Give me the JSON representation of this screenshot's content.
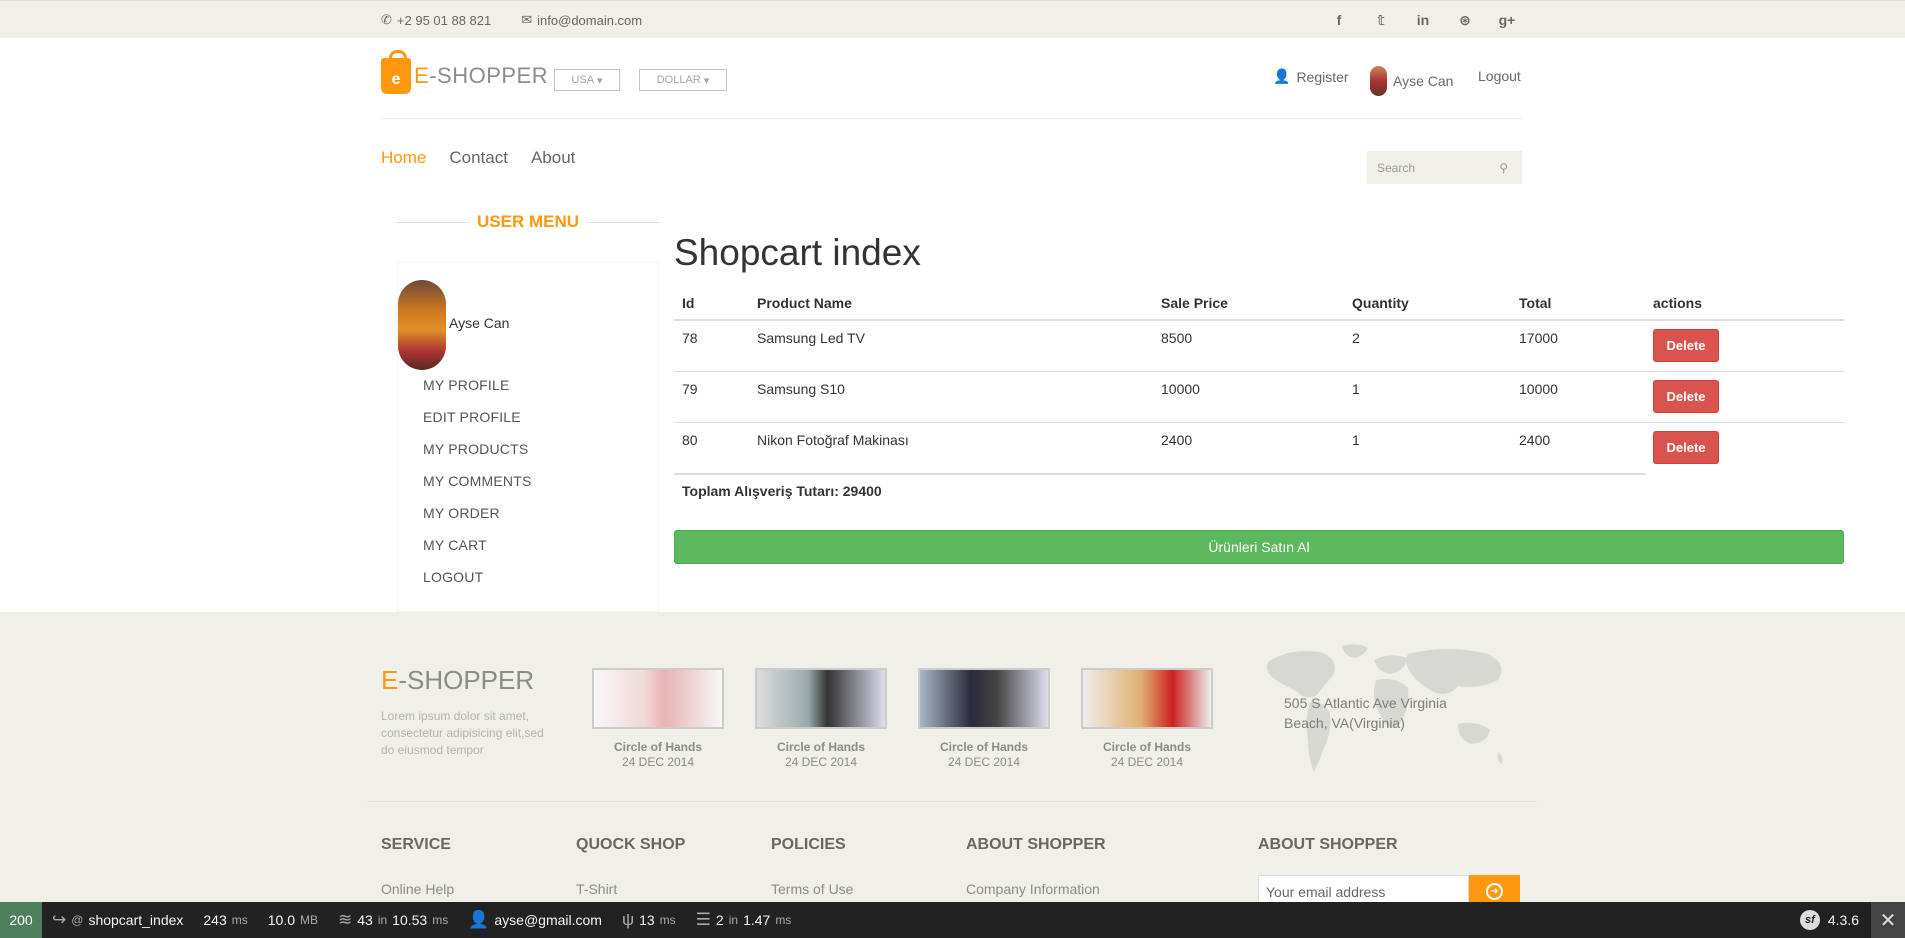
{
  "topbar": {
    "phone": "+2 95 01 88 821",
    "email": "info@domain.com",
    "social_icons": [
      "facebook-icon",
      "twitter-icon",
      "linkedin-icon",
      "dribbble-icon",
      "google-plus-icon"
    ],
    "social_glyphs": [
      "f",
      "𝕥",
      "in",
      "⊛",
      "g+"
    ]
  },
  "header": {
    "logo_e": "E",
    "logo_rest": "-SHOPPER",
    "country": "USA",
    "currency": "DOLLAR",
    "register": "Register",
    "user": "Ayse Can",
    "logout": "Logout"
  },
  "nav": {
    "home": "Home",
    "contact": "Contact",
    "about": "About",
    "search_placeholder": "Search"
  },
  "sidebar": {
    "title": "USER MENU",
    "name": "Ayse Can",
    "items": [
      "MY PROFILE",
      "EDIT PROFILE",
      "MY PRODUCTS",
      "MY COMMENTS",
      "MY ORDER",
      "MY CART",
      "LOGOUT"
    ]
  },
  "cart": {
    "title": "Shopcart index",
    "columns": [
      "Id",
      "Product Name",
      "Sale Price",
      "Quantity",
      "Total",
      "actions"
    ],
    "rows": [
      {
        "id": "78",
        "name": "Samsung Led TV",
        "price": "8500",
        "qty": "2",
        "total": "17000",
        "action": "Delete"
      },
      {
        "id": "79",
        "name": "Samsung S10",
        "price": "10000",
        "qty": "1",
        "total": "10000",
        "action": "Delete"
      },
      {
        "id": "80",
        "name": "Nikon Fotoğraf Makinası",
        "price": "2400",
        "qty": "1",
        "total": "2400",
        "action": "Delete"
      }
    ],
    "total_text": "Toplam Alışveriş Tutarı: 29400",
    "buy_button": "Ürünleri Satın Al"
  },
  "footer": {
    "logo_e": "E",
    "logo_rest": "-SHOPPER",
    "desc": "Lorem ipsum dolor sit amet, consectetur adipisicing elit,sed do eiusmod tempor",
    "videos": [
      {
        "title": "Circle of Hands",
        "date": "24 DEC 2014"
      },
      {
        "title": "Circle of Hands",
        "date": "24 DEC 2014"
      },
      {
        "title": "Circle of Hands",
        "date": "24 DEC 2014"
      },
      {
        "title": "Circle of Hands",
        "date": "24 DEC 2014"
      }
    ],
    "address": "505 S Atlantic Ave Virginia Beach, VA(Virginia)",
    "columns": [
      {
        "title": "SERVICE",
        "first": "Online Help"
      },
      {
        "title": "QUOCK SHOP",
        "first": "T-Shirt"
      },
      {
        "title": "POLICIES",
        "first": "Terms of Use"
      },
      {
        "title": "ABOUT SHOPPER",
        "first": "Company Information"
      },
      {
        "title": "ABOUT SHOPPER",
        "first": ""
      }
    ],
    "subscribe_placeholder": "Your email address"
  },
  "debug": {
    "status": "200",
    "route": "shopcart_index",
    "time": "243",
    "time_unit": "ms",
    "memory": "10.0",
    "memory_unit": "MB",
    "cache": "43",
    "cache_in": "in",
    "cache_time": "10.53",
    "cache_unit": "ms",
    "user": "ayse@gmail.com",
    "twig": "13",
    "twig_unit": "ms",
    "db": "2",
    "db_in": "in",
    "db_time": "1.47",
    "db_unit": "ms",
    "version": "4.3.6"
  }
}
